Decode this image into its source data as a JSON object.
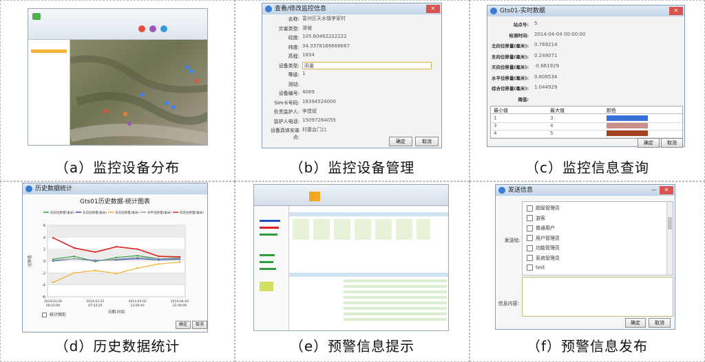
{
  "captions": {
    "a": "（a）监控设备分布",
    "b": "（b）监控设备管理",
    "c": "（c）监控信息查询",
    "d": "（d）历史数据统计",
    "e": "（e）预警信息提示",
    "f": "（f）预警信息发布"
  },
  "panel_b": {
    "title": "查看/修改监控信息",
    "fields": [
      {
        "label": "名称:",
        "value": "富州区天水镇李家村"
      },
      {
        "label": "灾害类型:",
        "value": "滑坡"
      },
      {
        "label": "经度:",
        "value": "105.60462222222"
      },
      {
        "label": "纬度:",
        "value": "34.3378166666667"
      },
      {
        "label": "高程:",
        "value": "1834"
      },
      {
        "label": "设备类型:",
        "value": "雨量"
      },
      {
        "label": "等级:",
        "value": "1"
      },
      {
        "label": "测站:",
        "value": ""
      },
      {
        "label": "设备编号:",
        "value": "4089"
      },
      {
        "label": "Sim卡号码:",
        "value": "18394524000"
      },
      {
        "label": "负责监护人:",
        "value": "李建斌"
      },
      {
        "label": "监护人电话:",
        "value": "15097284055"
      },
      {
        "label": "设备具体安装点:",
        "value": "村委会门口"
      }
    ],
    "ok": "确定",
    "cancel": "取消"
  },
  "panel_c": {
    "title": "Gts01-实时数据",
    "fields": [
      {
        "label": "站点号:",
        "value": "5"
      },
      {
        "label": "检测时间:",
        "value": "2014-04-04 00:00:00"
      },
      {
        "label": "北向位移量(毫米):",
        "value": "0.769214"
      },
      {
        "label": "东向位移量(毫米):",
        "value": "0.249071"
      },
      {
        "label": "天向位移量(毫米):",
        "value": "-0.661929"
      },
      {
        "label": "水平位移量(毫米):",
        "value": "0.808534"
      },
      {
        "label": "综合位移量(毫米):",
        "value": "1.044929"
      },
      {
        "label": "阈值:",
        "value": ""
      }
    ],
    "table_headers": [
      "最小值",
      "最大值",
      "颜色"
    ],
    "table_rows": [
      {
        "min": "1",
        "max": "3",
        "color": "#3a6fd8"
      },
      {
        "min": "3",
        "max": "4",
        "color": "#c9908a"
      },
      {
        "min": "4",
        "max": "5",
        "color": "#a4421f"
      }
    ],
    "ok": "确定",
    "cancel": "取消"
  },
  "panel_d": {
    "window_title": "历史数据统计",
    "ok": "确定",
    "cancel": "取消",
    "checkbox_label": "统计图形",
    "chart_data": {
      "type": "line",
      "title": "Gts01历史数据-统计图表",
      "xlabel": "日期-时间",
      "ylabel": "位移值",
      "ylim": [
        -6,
        6
      ],
      "x": [
        "2014-03-26 09:03:00",
        "2014-03-29",
        "2014-03-31 07:03:20",
        "2014-04-01",
        "2014-04-02 13:00:40",
        "2014-04-03",
        "2014-04-04 22:40:00"
      ],
      "x_ticks": [
        "2014-03-26\n09:03:00",
        "2014-03-31\n07:03:20",
        "2014-04-02\n13:00:40",
        "2014-04-04\n22:40:00"
      ],
      "y_ticks": [
        "6",
        "4",
        "2",
        "0",
        "-2",
        "-4",
        "-6"
      ],
      "series": [
        {
          "name": "北向位移量(毫米)",
          "color": "#2e9e3a",
          "values": [
            0.3,
            0.8,
            -0.1,
            0.6,
            0.9,
            0.4,
            0.5
          ]
        },
        {
          "name": "东向位移量(毫米)",
          "color": "#1f4fbf",
          "values": [
            0.0,
            0.4,
            0.1,
            0.2,
            0.4,
            0.2,
            0.3
          ]
        },
        {
          "name": "天向位移量(毫米)",
          "color": "#f5a623",
          "values": [
            -3.6,
            -2.0,
            -1.6,
            -2.1,
            -1.2,
            -0.5,
            -0.2
          ]
        },
        {
          "name": "水平位移量(毫米)",
          "color": "#999999",
          "values": [
            0.1,
            0.4,
            0.0,
            0.3,
            0.6,
            0.4,
            0.4
          ]
        },
        {
          "name": "综合位移量(毫米)",
          "color": "#e02020",
          "values": [
            3.9,
            2.2,
            1.5,
            2.4,
            2.0,
            0.8,
            0.7
          ]
        }
      ]
    }
  },
  "panel_f": {
    "title": "发送信息",
    "send_to_label": "发送给:",
    "content_label": "信息内容:",
    "recipients": [
      "超级管理员",
      "游客",
      "普通用户",
      "用户管理员",
      "功能管理员",
      "系统管理员",
      "test"
    ],
    "ok": "确定",
    "cancel": "取消"
  }
}
